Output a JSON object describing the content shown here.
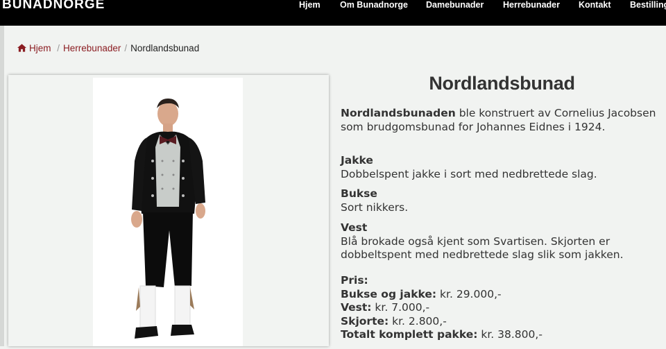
{
  "header": {
    "logo": "BUNADNORGE",
    "nav": [
      "Hjem",
      "Om Bunadnorge",
      "Damebunader",
      "Herrebunader",
      "Kontakt",
      "Bestilling"
    ]
  },
  "breadcrumb": {
    "home": "Hjem",
    "category": "Herrebunader",
    "current": "Nordlandsbunad"
  },
  "product": {
    "title": "Nordlandsbunad",
    "intro_bold": "Nordlandsbunaden",
    "intro_text": " ble konstruert av Cornelius Jacobsen som brudgomsbunad for Johannes Eidnes i 1924.",
    "jakke_heading": "Jakke",
    "jakke_text": "Dobbelspent jakke i sort med nedbrettede slag.",
    "bukse_heading": "Bukse",
    "bukse_text": "Sort nikkers.",
    "vest_heading": "Vest",
    "vest_text": "Blå brokade også kjent som Svartisen. Skjorten er dobbeltspent med nedbrettede slag slik som jakken.",
    "price_heading": "Pris:",
    "prices": [
      {
        "label": "Bukse og jakke:",
        "value": " kr. 29.000,-"
      },
      {
        "label": "Vest:",
        "value": " kr. 7.000,-"
      },
      {
        "label": "Skjorte:",
        "value": " kr. 2.800,-"
      },
      {
        "label": "Totalt komplett pakke:",
        "value": " kr. 38.800,-"
      }
    ]
  },
  "colors": {
    "topbar": "#000000",
    "link": "#8b1d22",
    "background": "#f1f3f1"
  }
}
